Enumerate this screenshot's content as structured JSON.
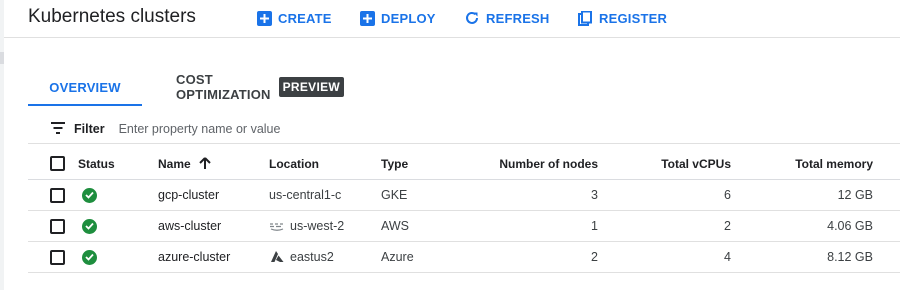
{
  "header": {
    "title": "Kubernetes clusters",
    "actions": [
      {
        "label": "CREATE",
        "icon": "add-box-icon"
      },
      {
        "label": "DEPLOY",
        "icon": "add-box-icon"
      },
      {
        "label": "REFRESH",
        "icon": "refresh-icon"
      },
      {
        "label": "REGISTER",
        "icon": "register-icon"
      }
    ]
  },
  "tabs": {
    "overview": "OVERVIEW",
    "cost": "COST OPTIMIZATION",
    "preview_badge": "PREVIEW",
    "active": "OVERVIEW"
  },
  "filter": {
    "label": "Filter",
    "placeholder": "Enter property name or value"
  },
  "table": {
    "columns": {
      "status": "Status",
      "name": "Name",
      "location": "Location",
      "type": "Type",
      "nodes": "Number of nodes",
      "vcpus": "Total vCPUs",
      "memory": "Total memory"
    },
    "sort": {
      "column": "Name",
      "direction": "ascending"
    },
    "rows": [
      {
        "name": "gcp-cluster",
        "location": "us-central1-c",
        "location_icon": "",
        "type": "GKE",
        "nodes": "3",
        "vcpus": "6",
        "memory": "12 GB",
        "status": "ok"
      },
      {
        "name": "aws-cluster",
        "location": "us-west-2",
        "location_icon": "aws-icon",
        "type": "AWS",
        "nodes": "1",
        "vcpus": "2",
        "memory": "4.06 GB",
        "status": "ok"
      },
      {
        "name": "azure-cluster",
        "location": "eastus2",
        "location_icon": "azure-icon",
        "type": "Azure",
        "nodes": "2",
        "vcpus": "4",
        "memory": "8.12 GB",
        "status": "ok"
      }
    ]
  },
  "colors": {
    "accent": "#1a73e8",
    "status_ok": "#1e8e3e",
    "badge_bg": "#3c4043"
  }
}
